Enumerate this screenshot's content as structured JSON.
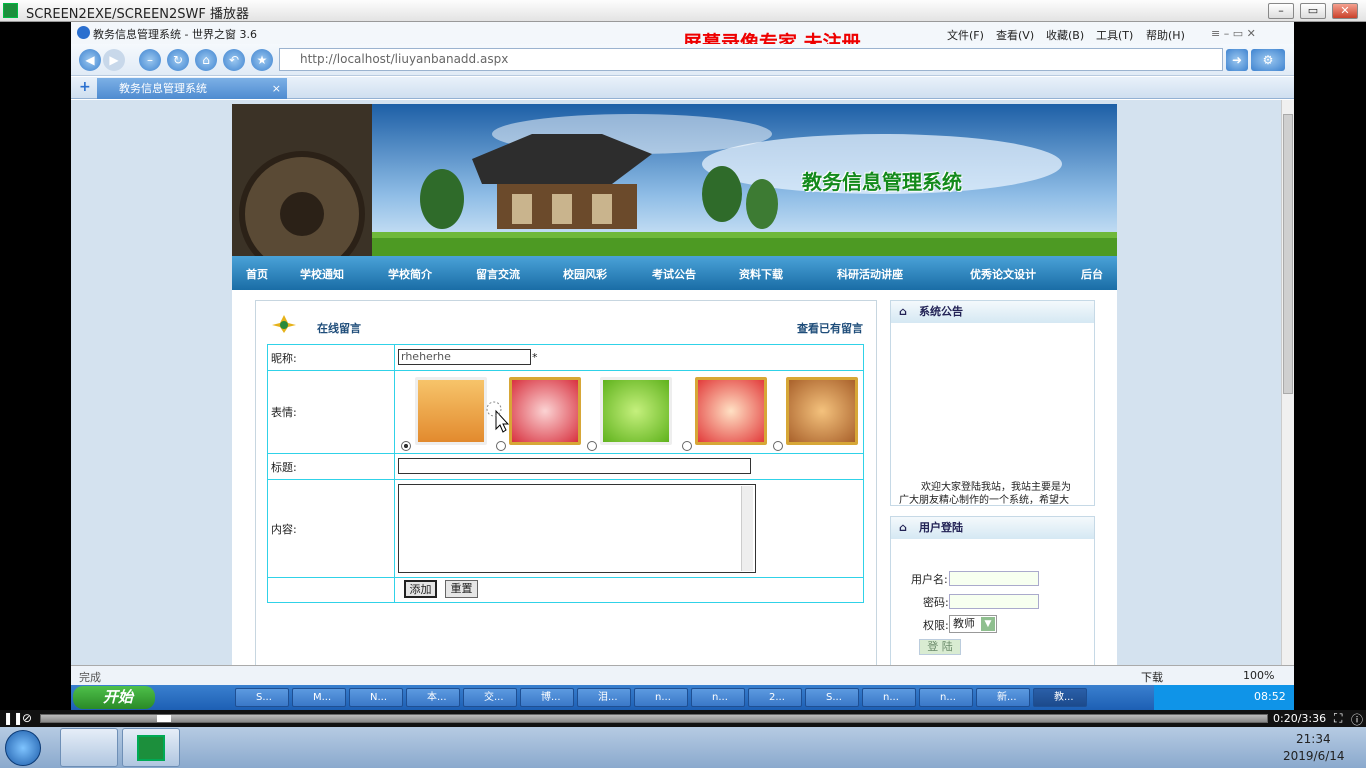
{
  "player": {
    "title": "SCREEN2EXE/SCREEN2SWF 播放器",
    "time": "0:20/3:36",
    "progress": 0.095
  },
  "browser": {
    "title": "教务信息管理系统 - 世界之窗 3.6",
    "watermark": "屏幕录像专家  未注册",
    "menus": [
      "文件(F)",
      "查看(V)",
      "收藏(B)",
      "工具(T)",
      "帮助(H)"
    ],
    "address": "http://localhost/liuyanbanadd.aspx",
    "tab": "教务信息管理系统",
    "status_left": "完成",
    "status_download": "下载",
    "zoom": "100%"
  },
  "site": {
    "title": "教务信息管理系统",
    "nav": [
      "首页",
      "学校通知",
      "学校简介",
      "留言交流",
      "校园风彩",
      "考试公告",
      "资料下载",
      "科研活动讲座",
      "优秀论文设计",
      "后台"
    ]
  },
  "message": {
    "header": "在线留言",
    "view_link": "查看已有留言",
    "nickname_label": "昵称:",
    "nickname_value": "rheherhe",
    "required": "*",
    "face_label": "表情:",
    "title_label": "标题:",
    "content_label": "内容:",
    "add_button": "添加",
    "reset_button": "重置",
    "selected_face": 0
  },
  "notice": {
    "header": "系统公告",
    "text1": "欢迎大家登陆我站，我站主要是为",
    "text2": "广大朋友精心制作的一个系统，希望大"
  },
  "login": {
    "header": "用户登陆",
    "user_label": "用户名:",
    "pass_label": "密码:",
    "role_label": "权限:",
    "role_value": "教师",
    "submit": "登 陆"
  },
  "taskbar": {
    "start": "开始",
    "items": [
      "S...",
      "M...",
      "N...",
      "本...",
      "交...",
      "博...",
      "泪...",
      "n...",
      "n...",
      "2...",
      "S...",
      "n...",
      "n...",
      "新...",
      "教..."
    ],
    "tray_time": "08:52"
  },
  "win7": {
    "time": "21:34",
    "date": "2019/6/14"
  }
}
